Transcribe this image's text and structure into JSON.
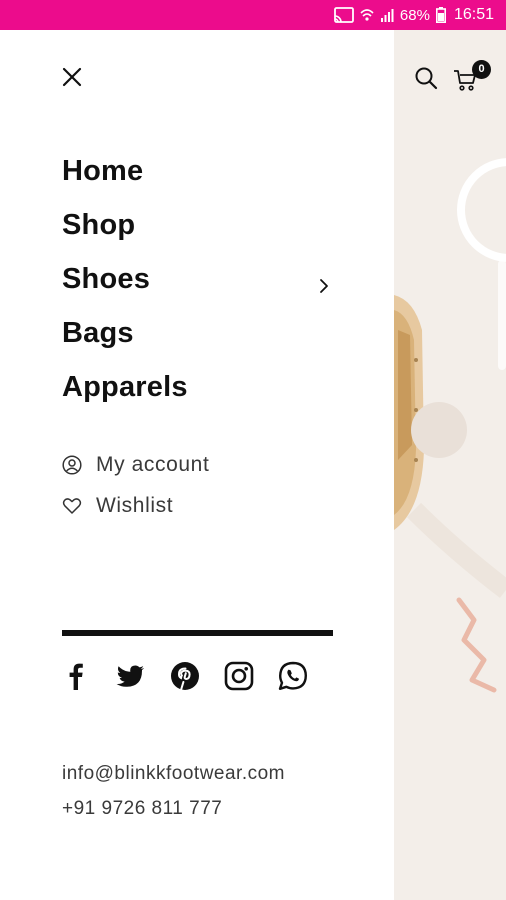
{
  "status_bar": {
    "battery": "68%",
    "time": "16:51"
  },
  "header": {
    "cart_count": "0"
  },
  "drawer": {
    "menu": [
      {
        "label": "Home"
      },
      {
        "label": "Shop"
      },
      {
        "label": "Shoes"
      },
      {
        "label": "Bags"
      },
      {
        "label": "Apparels"
      }
    ],
    "account_links": [
      {
        "label": "My account",
        "icon": "user-circle-icon"
      },
      {
        "label": "Wishlist",
        "icon": "heart-icon"
      }
    ],
    "social": [
      "facebook-icon",
      "twitter-icon",
      "pinterest-icon",
      "instagram-icon",
      "whatsapp-icon"
    ],
    "contact": {
      "email": "info@blinkkfootwear.com",
      "phone": "+91 9726 811 777"
    }
  },
  "colors": {
    "status_bar": "#ec0c8c",
    "text": "#111111",
    "background_page": "#f3eee9"
  }
}
